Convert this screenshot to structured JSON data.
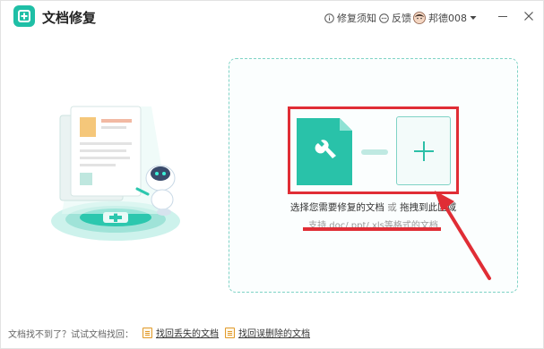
{
  "app": {
    "title": "文档修复"
  },
  "titlebar": {
    "help_label": "修复须知",
    "feedback_label": "反馈",
    "username": "邦德008"
  },
  "dropzone": {
    "hint_main": "选择您需要修复的文档",
    "hint_or": "或",
    "hint_drag": "拖拽到此区域",
    "support_text": "支持.doc/.ppt/.xls等格式的文档"
  },
  "footer": {
    "hint": "文档找不到了？试试文档找回：",
    "link_lost": "找回丢失的文档",
    "link_deleted": "找回误删除的文档"
  },
  "colors": {
    "accent": "#1fbfa6",
    "annotation": "#e02d35",
    "border_dashed": "#7fd3c6"
  },
  "icons": {
    "app_logo": "plus-box-icon",
    "help": "info-circle-icon",
    "feedback": "chat-bubble-icon",
    "minimize": "minimize-icon",
    "close": "close-icon",
    "document": "wrench-document-icon",
    "add": "plus-icon"
  }
}
